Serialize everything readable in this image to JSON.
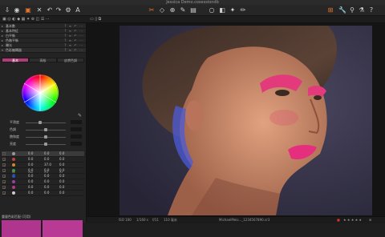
{
  "window": {
    "title": "Jessica Demo.cosessiondb"
  },
  "toolbar": {
    "left_icons": [
      "import-icon",
      "capture-icon",
      "library-icon",
      "cursor-icon",
      "delete-icon",
      "undo-icon",
      "redo-icon",
      "settings-icon",
      "text-icon"
    ],
    "center_icons": [
      "crop-icon",
      "keystone-icon",
      "spot-icon",
      "brush-icon",
      "gradient-icon",
      "circle-icon",
      "eraser-icon",
      "picker-icon",
      "annotate-icon"
    ],
    "right_icons": [
      "process-icon",
      "tools-icon",
      "pin-icon",
      "eye-dropper-icon",
      "help-icon"
    ]
  },
  "secondbar": {
    "left_icons": [
      "grid-icon",
      "viewer-icon",
      "compare-icon"
    ]
  },
  "tool_rows": [
    {
      "label": "基本數"
    },
    {
      "label": "基本特征"
    },
    {
      "label": "白平衡"
    },
    {
      "label": "色階平衡"
    },
    {
      "label": "曝光"
    },
    {
      "label": "色彩編輯器"
    }
  ],
  "tabs": [
    {
      "label": "基本",
      "active": true
    },
    {
      "label": "高級",
      "active": false
    },
    {
      "label": "皮膚色調",
      "active": false
    }
  ],
  "sliders": [
    {
      "label": "平滑度",
      "value": "",
      "pos": 0.35
    },
    {
      "label": "色調",
      "value": "",
      "pos": 0.5
    },
    {
      "label": "飽和度",
      "value": "",
      "pos": 0.5
    },
    {
      "label": "亮度",
      "value": "",
      "pos": 0.5
    }
  ],
  "table": {
    "headers": [
      "",
      "色",
      "ΔH",
      "ΔS",
      "ΔL"
    ],
    "rows": [
      {
        "color": "#999999",
        "h": "0.0",
        "s": "0.0",
        "l": "0.0",
        "checked": false,
        "selected": true
      },
      {
        "color": "#c33f3f",
        "h": "0.0",
        "s": "0.0",
        "l": "0.0",
        "checked": true
      },
      {
        "color": "#d6822e",
        "h": "0.0",
        "s": "37.0",
        "l": "0.0",
        "checked": true
      },
      {
        "color": "#3e9a3e",
        "h": "0.0",
        "s": "0.0",
        "l": "0.0",
        "checked": true
      },
      {
        "color": "#2f4fc4",
        "h": "0.0",
        "s": "0.0",
        "l": "0.0",
        "checked": true
      },
      {
        "color": "#9640a8",
        "h": "0.0",
        "s": "0.0",
        "l": "0.0",
        "checked": true
      },
      {
        "color": "#b33a8a",
        "h": "0.0",
        "s": "0.0",
        "l": "0.0",
        "checked": true
      },
      {
        "color": "#cccccc",
        "h": "0.0",
        "s": "0.0",
        "l": "0.0",
        "checked": true
      }
    ]
  },
  "bottom_label": "重量色彩匹配 (可用)",
  "swatches": [
    "#b0358f",
    "#b83a94"
  ],
  "status": {
    "iso": "ISO 100",
    "shutter": "1/160 s",
    "aperture": "f/11",
    "focal": "110 毫米",
    "filename": "MichaelMeis..._1234567890.cr3"
  },
  "colors": {
    "accent": "#e8742a",
    "active_tab": "#b23a78"
  }
}
